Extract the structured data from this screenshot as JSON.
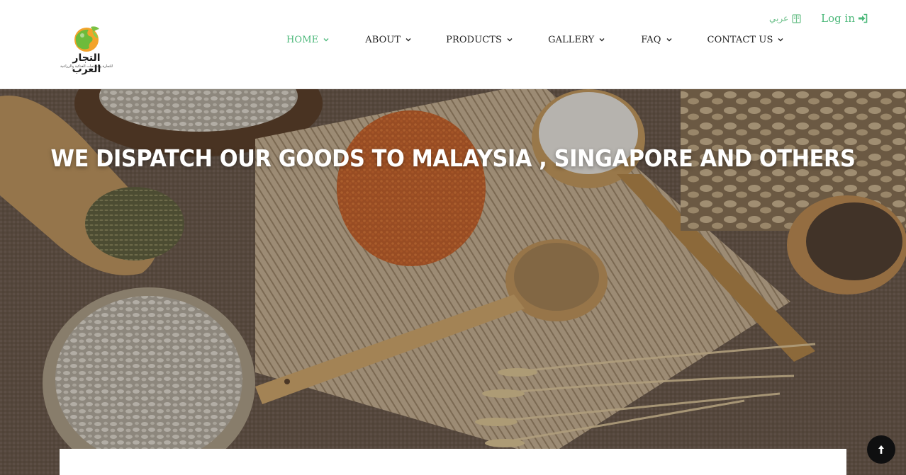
{
  "brand": {
    "logo_text": "التجار العرب",
    "logo_subtext": "للتجارة والمنتجات الغذائية والزراعية"
  },
  "topbar": {
    "language_label": "عربي",
    "login_label": "Log in"
  },
  "nav": {
    "items": [
      {
        "label": "HOME",
        "active": true
      },
      {
        "label": "ABOUT",
        "active": false
      },
      {
        "label": "PRODUCTS",
        "active": false
      },
      {
        "label": "GALLERY",
        "active": false
      },
      {
        "label": "FAQ",
        "active": false
      },
      {
        "label": "CONTACT US",
        "active": false
      }
    ]
  },
  "hero": {
    "title": "WE DISPATCH OUR GOODS TO MALAYSIA , SINGAPORE AND OTHERS"
  },
  "icons": {
    "language": "language-book-icon",
    "login": "sign-in-icon",
    "dropdown": "chevron-down-icon",
    "scroll_top": "arrow-up-icon"
  },
  "colors": {
    "accent": "#4cb87a",
    "nav_text": "#222222",
    "scroll_button": "#0f0f10",
    "hero_text": "#ffffff"
  }
}
